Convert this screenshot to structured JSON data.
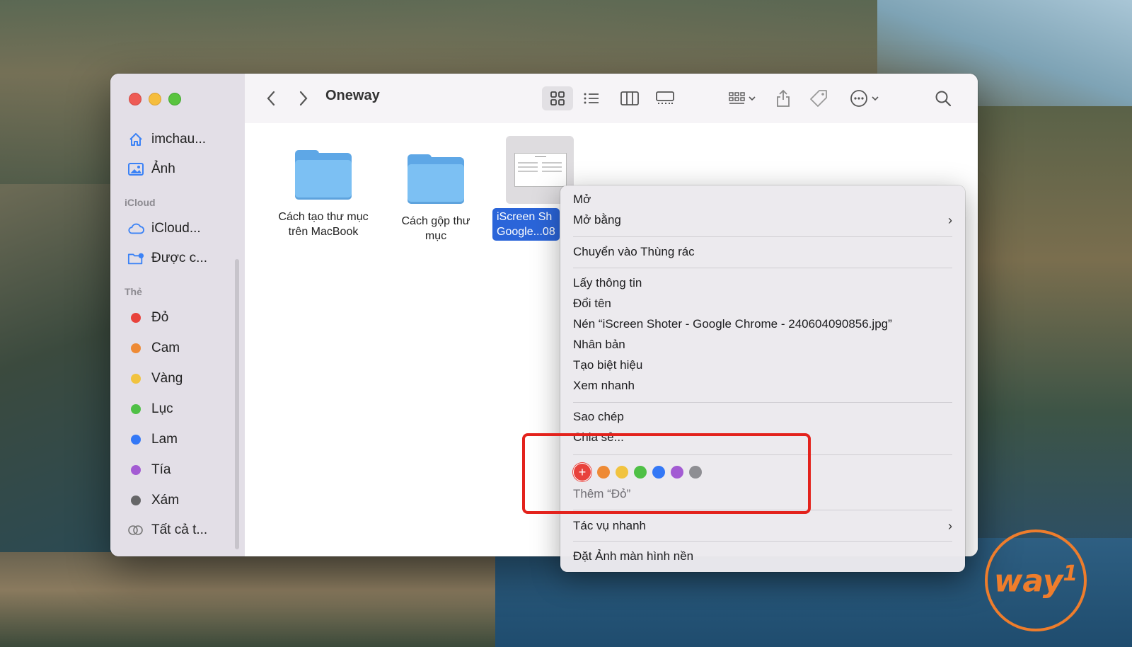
{
  "window": {
    "title": "Oneway"
  },
  "sidebar": {
    "favorites": [
      {
        "label": "imchau...",
        "icon": "home-icon"
      },
      {
        "label": "Ảnh",
        "icon": "photos-icon"
      }
    ],
    "icloud_header": "iCloud",
    "icloud": [
      {
        "label": "iCloud...",
        "icon": "cloud-icon"
      },
      {
        "label": "Được c...",
        "icon": "shared-folder-icon"
      }
    ],
    "tags_header": "Thẻ",
    "tags": [
      {
        "label": "Đỏ",
        "color": "#e8423c"
      },
      {
        "label": "Cam",
        "color": "#ee8a35"
      },
      {
        "label": "Vàng",
        "color": "#f1c33f"
      },
      {
        "label": "Lục",
        "color": "#4fc046"
      },
      {
        "label": "Lam",
        "color": "#3478f6"
      },
      {
        "label": "Tía",
        "color": "#a35bd3"
      },
      {
        "label": "Xám",
        "color": "#666668"
      }
    ],
    "all_tags": "Tất cả t..."
  },
  "files": [
    {
      "name_line1": "Cách tạo thư mục",
      "name_line2": "trên MacBook",
      "type": "folder"
    },
    {
      "name_line1": "Cách gộp thư",
      "name_line2": "mục",
      "type": "folder"
    },
    {
      "name_line1": "iScreen Sh",
      "name_line2": "Google...08",
      "type": "image",
      "selected": true
    }
  ],
  "context_menu": {
    "open": "Mở",
    "open_with": "Mở bằng",
    "move_to_trash": "Chuyển vào Thùng rác",
    "get_info": "Lấy thông tin",
    "rename": "Đổi tên",
    "compress": "Nén “iScreen Shoter - Google Chrome - 240604090856.jpg”",
    "duplicate": "Nhân bản",
    "make_alias": "Tạo biệt hiệu",
    "quick_look": "Xem nhanh",
    "copy": "Sao chép",
    "share": "Chia sẻ...",
    "tag_colors": [
      "#e8423c",
      "#ee8a35",
      "#f1c33f",
      "#4fc046",
      "#3478f6",
      "#a35bd3",
      "#8e8e93"
    ],
    "add_tag_label": "Thêm “Đỏ”",
    "quick_actions": "Tác vụ nhanh",
    "set_desktop": "Đặt Ảnh màn hình nền"
  },
  "logo": {
    "text": "way",
    "digit": "1",
    "color": "#ee7d2c"
  },
  "highlight_color": "#e3221c"
}
